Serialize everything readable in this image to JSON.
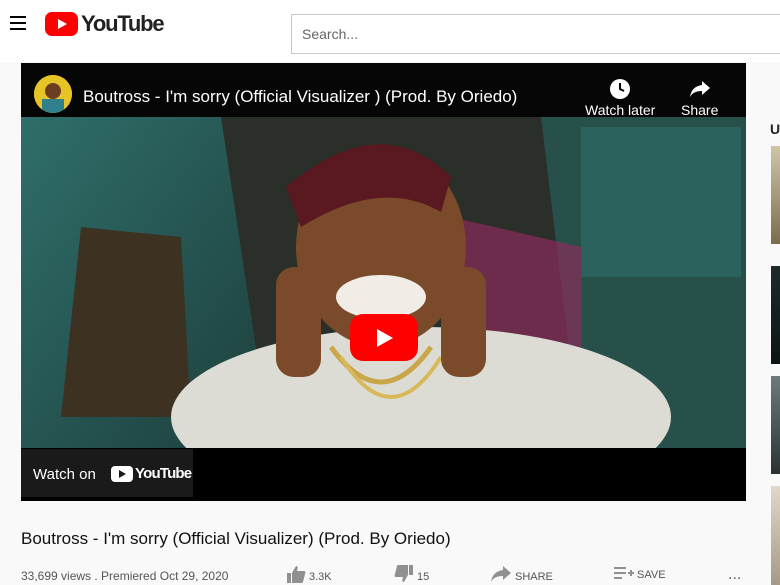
{
  "header": {
    "logo_text": "YouTube",
    "search_placeholder": "Search..."
  },
  "player": {
    "video_title": "Boutross - I'm sorry (Official Visualizer ) (Prod. By Oriedo)",
    "watch_later_label": "Watch later",
    "share_label": "Share",
    "watch_on_label": "Watch on",
    "watch_on_brand": "YouTube"
  },
  "video": {
    "title": "Boutross - I'm sorry (Official Visualizer) (Prod. By Oriedo)",
    "meta": "33,699 views . Premiered Oct 29, 2020",
    "like_count": "3.3K",
    "dislike_count": "15",
    "share_label": "SHARE",
    "save_label": "SAVE",
    "more_label": "..."
  },
  "rail": {
    "heading": "U"
  },
  "colors": {
    "brand_red": "#ff0000",
    "player_bg": "#000000",
    "page_bg": "#f9f9f9"
  }
}
